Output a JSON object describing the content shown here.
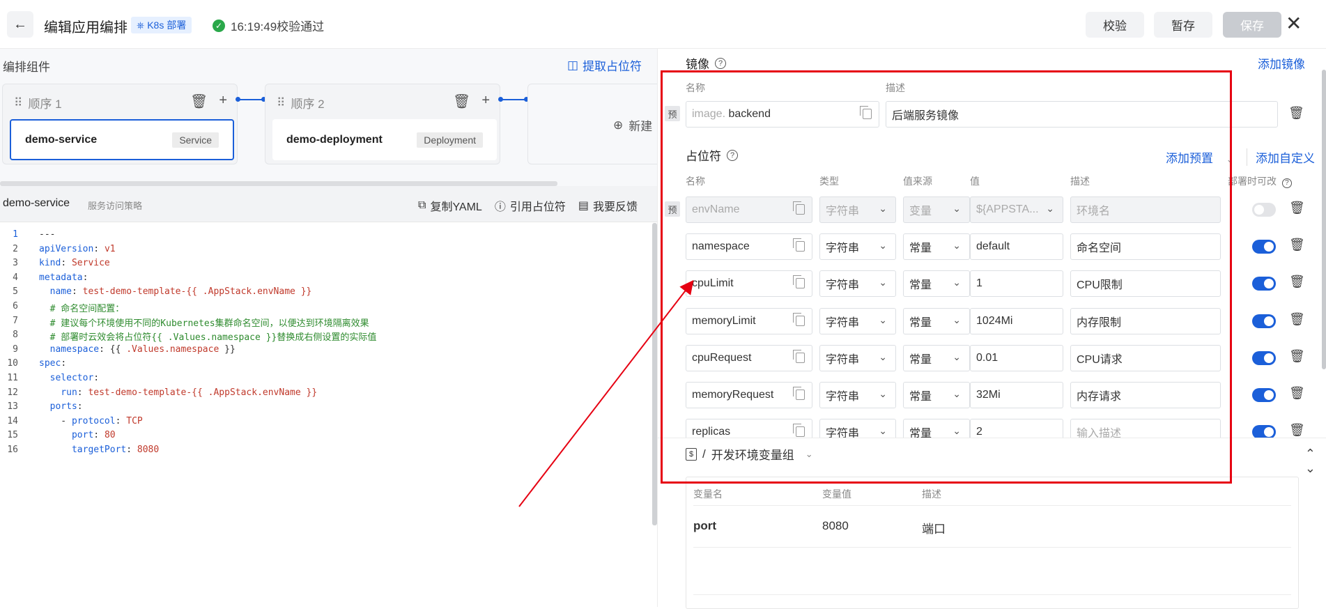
{
  "header": {
    "title": "编辑应用编排",
    "badge": "K8s 部署",
    "status": "16:19:49校验通过",
    "validate_label": "校验",
    "draft_label": "暂存",
    "save_label": "保存"
  },
  "components": {
    "label": "编排组件",
    "extract_label": "提取占位符",
    "cards": [
      {
        "order": "顺序 1",
        "name": "demo-service",
        "type": "Service"
      },
      {
        "order": "顺序 2",
        "name": "demo-deployment",
        "type": "Deployment"
      }
    ],
    "new_label": "新建"
  },
  "editor": {
    "name": "demo-service",
    "subtitle": "服务访问策略",
    "copy_label": "复制YAML",
    "ref_label": "引用占位符",
    "feedback_label": "我要反馈",
    "lines": [
      {
        "n": "1",
        "parts": [
          {
            "t": "---",
            "c": "p"
          }
        ]
      },
      {
        "n": "2",
        "parts": [
          {
            "t": "apiVersion",
            "c": "k"
          },
          {
            "t": ": ",
            "c": "p"
          },
          {
            "t": "v1",
            "c": "v"
          }
        ]
      },
      {
        "n": "3",
        "parts": [
          {
            "t": "kind",
            "c": "k"
          },
          {
            "t": ": ",
            "c": "p"
          },
          {
            "t": "Service",
            "c": "v"
          }
        ]
      },
      {
        "n": "4",
        "parts": [
          {
            "t": "metadata",
            "c": "k"
          },
          {
            "t": ":",
            "c": "p"
          }
        ]
      },
      {
        "n": "5",
        "parts": [
          {
            "t": "  name",
            "c": "k"
          },
          {
            "t": ": ",
            "c": "p"
          },
          {
            "t": "test-demo-template-{{ .AppStack.envName }}",
            "c": "v"
          }
        ]
      },
      {
        "n": "6",
        "parts": [
          {
            "t": "  # 命名空间配置：",
            "c": "c"
          }
        ]
      },
      {
        "n": "7",
        "parts": [
          {
            "t": "  # 建议每个环境使用不同的Kubernetes集群命名空间，以便达到环境隔离效果",
            "c": "c"
          }
        ]
      },
      {
        "n": "8",
        "parts": [
          {
            "t": "  # 部署时云效会将占位符{{ .Values.namespace }}替换成右侧设置的实际值",
            "c": "c"
          }
        ]
      },
      {
        "n": "9",
        "parts": [
          {
            "t": "  namespace",
            "c": "k"
          },
          {
            "t": ": {{ ",
            "c": "p"
          },
          {
            "t": ".Values.namespace",
            "c": "v"
          },
          {
            "t": " }}",
            "c": "p"
          }
        ]
      },
      {
        "n": "10",
        "parts": [
          {
            "t": "spec",
            "c": "k"
          },
          {
            "t": ":",
            "c": "p"
          }
        ]
      },
      {
        "n": "11",
        "parts": [
          {
            "t": "  selector",
            "c": "k"
          },
          {
            "t": ":",
            "c": "p"
          }
        ]
      },
      {
        "n": "12",
        "parts": [
          {
            "t": "    run",
            "c": "k"
          },
          {
            "t": ": ",
            "c": "p"
          },
          {
            "t": "test-demo-template-{{ .AppStack.envName }}",
            "c": "v"
          }
        ]
      },
      {
        "n": "13",
        "parts": [
          {
            "t": "  ports",
            "c": "k"
          },
          {
            "t": ":",
            "c": "p"
          }
        ]
      },
      {
        "n": "14",
        "parts": [
          {
            "t": "    - ",
            "c": "p"
          },
          {
            "t": "protocol",
            "c": "k"
          },
          {
            "t": ": ",
            "c": "p"
          },
          {
            "t": "TCP",
            "c": "v"
          }
        ]
      },
      {
        "n": "15",
        "parts": [
          {
            "t": "      port",
            "c": "k"
          },
          {
            "t": ": ",
            "c": "p"
          },
          {
            "t": "80",
            "c": "v"
          }
        ]
      },
      {
        "n": "16",
        "parts": [
          {
            "t": "      targetPort",
            "c": "k"
          },
          {
            "t": ": ",
            "c": "p"
          },
          {
            "t": "8080",
            "c": "v"
          }
        ]
      }
    ]
  },
  "image_section": {
    "title": "镜像",
    "add_label": "添加镜像",
    "col_name": "名称",
    "col_desc": "描述",
    "preset_tag": "预",
    "name_prefix": "image.",
    "name_value": "backend",
    "desc_value": "后端服务镜像"
  },
  "placeholder_section": {
    "title": "占位符",
    "add_preset_label": "添加预置",
    "add_custom_label": "添加自定义",
    "columns": [
      "名称",
      "类型",
      "值来源",
      "值",
      "描述",
      "部署时可改"
    ],
    "rows": [
      {
        "preset": "预",
        "name": "envName",
        "type": "字符串",
        "source": "变量",
        "value": "${APPSTA...",
        "desc": "环境名",
        "desc_placeholder": "",
        "editable": false,
        "disabled": true
      },
      {
        "preset": "",
        "name": "namespace",
        "type": "字符串",
        "source": "常量",
        "value": "default",
        "desc": "命名空间",
        "desc_placeholder": "",
        "editable": true,
        "disabled": false
      },
      {
        "preset": "",
        "name": "cpuLimit",
        "type": "字符串",
        "source": "常量",
        "value": "1",
        "desc": "CPU限制",
        "desc_placeholder": "",
        "editable": true,
        "disabled": false
      },
      {
        "preset": "",
        "name": "memoryLimit",
        "type": "字符串",
        "source": "常量",
        "value": "1024Mi",
        "desc": "内存限制",
        "desc_placeholder": "",
        "editable": true,
        "disabled": false
      },
      {
        "preset": "",
        "name": "cpuRequest",
        "type": "字符串",
        "source": "常量",
        "value": "0.01",
        "desc": "CPU请求",
        "desc_placeholder": "",
        "editable": true,
        "disabled": false
      },
      {
        "preset": "",
        "name": "memoryRequest",
        "type": "字符串",
        "source": "常量",
        "value": "32Mi",
        "desc": "内存请求",
        "desc_placeholder": "",
        "editable": true,
        "disabled": false
      },
      {
        "preset": "",
        "name": "replicas",
        "type": "字符串",
        "source": "常量",
        "value": "2",
        "desc": "",
        "desc_placeholder": "输入描述",
        "editable": true,
        "disabled": false
      }
    ]
  },
  "env_group": {
    "separator": "/",
    "name": "开发环境变量组",
    "columns": [
      "变量名",
      "变量值",
      "描述"
    ],
    "rows": [
      {
        "name": "port",
        "value": "8080",
        "desc": "端口"
      }
    ]
  },
  "colors": {
    "accent": "#1b5fd9",
    "annotation": "#e60012",
    "success": "#2aa84a"
  }
}
